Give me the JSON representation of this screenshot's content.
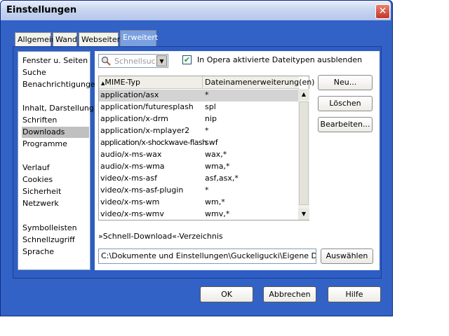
{
  "window": {
    "title": "Einstellungen"
  },
  "tabs": [
    {
      "label": "Allgemein"
    },
    {
      "label": "Wand"
    },
    {
      "label": "Webseiten"
    },
    {
      "label": "Erweitert"
    }
  ],
  "sidebar": {
    "items": [
      {
        "label": "Fenster u. Seiten"
      },
      {
        "label": "Suche"
      },
      {
        "label": "Benachrichtigungen"
      },
      {
        "label": "Inhalt, Darstellung"
      },
      {
        "label": "Schriften"
      },
      {
        "label": "Downloads"
      },
      {
        "label": "Programme"
      },
      {
        "label": "Verlauf"
      },
      {
        "label": "Cookies"
      },
      {
        "label": "Sicherheit"
      },
      {
        "label": "Netzwerk"
      },
      {
        "label": "Symbolleisten"
      },
      {
        "label": "Schnellzugriff"
      },
      {
        "label": "Sprache"
      }
    ],
    "selected": "Downloads"
  },
  "search": {
    "placeholder": "Schnellsuche"
  },
  "filter": {
    "label": "In Opera aktivierte Dateitypen ausblenden",
    "checked": true
  },
  "table": {
    "columns": [
      "MIME-Typ",
      "Dateinamenerweiterung(en)"
    ],
    "rows": [
      [
        "application/asx",
        "*"
      ],
      [
        "application/futuresplash",
        "spl"
      ],
      [
        "application/x-drm",
        "nip"
      ],
      [
        "application/x-mplayer2",
        "*"
      ],
      [
        "application/x-shockwave-flash",
        "swf"
      ],
      [
        "audio/x-ms-wax",
        "wax,*"
      ],
      [
        "audio/x-ms-wma",
        "wma,*"
      ],
      [
        "video/x-ms-asf",
        "asf,asx,*"
      ],
      [
        "video/x-ms-asf-plugin",
        "*"
      ],
      [
        "video/x-ms-wm",
        "wm,*"
      ],
      [
        "video/x-ms-wmv",
        "wmv,*"
      ]
    ]
  },
  "actions": {
    "new": "Neu...",
    "delete": "Löschen",
    "edit": "Bearbeiten..."
  },
  "download": {
    "label": "»Schnell-Download«-Verzeichnis",
    "path": "C:\\Dokumente und Einstellungen\\Guckeligucki\\Eigene Dateien\\",
    "choose": "Auswählen"
  },
  "footer": {
    "ok": "OK",
    "cancel": "Abbrechen",
    "help": "Hilfe"
  },
  "colors": {
    "frame": "#3362c6",
    "active_tab": "#7aa0e0",
    "close": "#c2352a"
  }
}
